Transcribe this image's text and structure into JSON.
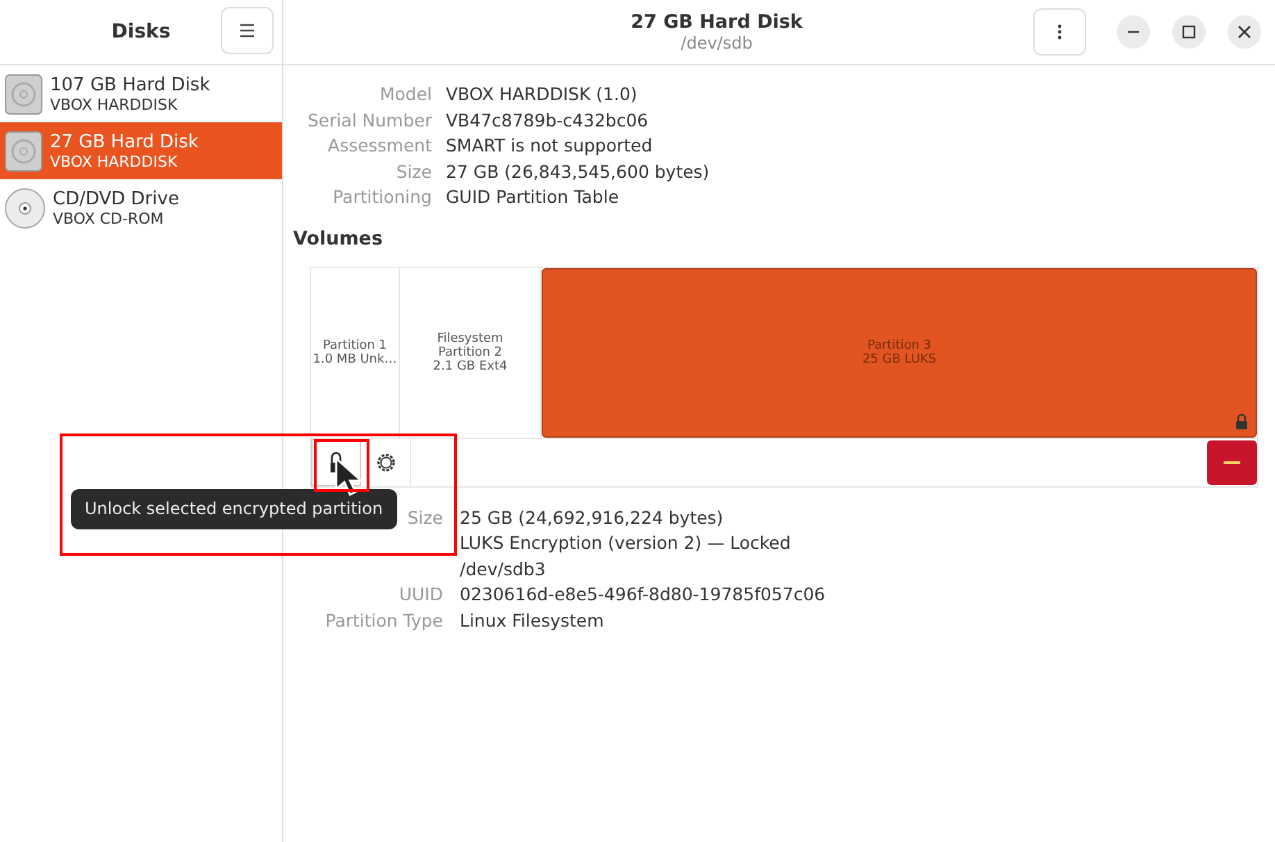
{
  "sidebar": {
    "title": "Disks",
    "items": [
      {
        "kind": "hdd",
        "name": "107 GB Hard Disk",
        "model": "VBOX HARDDISK",
        "selected": false
      },
      {
        "kind": "hdd",
        "name": "27 GB Hard Disk",
        "model": "VBOX HARDDISK",
        "selected": true
      },
      {
        "kind": "optical",
        "name": "CD/DVD Drive",
        "model": "VBOX CD-ROM",
        "selected": false
      }
    ]
  },
  "header": {
    "title": "27 GB Hard Disk",
    "subtitle": "/dev/sdb"
  },
  "disk_info": [
    {
      "label": "Model",
      "value": "VBOX HARDDISK (1.0)"
    },
    {
      "label": "Serial Number",
      "value": "VB47c8789b-c432bc06"
    },
    {
      "label": "Assessment",
      "value": "SMART is not supported"
    },
    {
      "label": "Size",
      "value": "27 GB (26,843,545,600 bytes)"
    },
    {
      "label": "Partitioning",
      "value": "GUID Partition Table"
    }
  ],
  "volumes": {
    "title": "Volumes",
    "partitions": [
      {
        "lines": [
          "Partition 1",
          "1.0 MB Unk…"
        ],
        "selected": false,
        "locked": false
      },
      {
        "lines": [
          "Filesystem",
          "Partition 2",
          "2.1 GB Ext4"
        ],
        "selected": false,
        "locked": false
      },
      {
        "lines": [
          "Partition 3",
          "25 GB LUKS"
        ],
        "selected": true,
        "locked": true
      }
    ],
    "tooltip": "Unlock selected encrypted partition"
  },
  "partition_info": [
    {
      "label": "Size",
      "value": "25 GB (24,692,916,224 bytes)"
    },
    {
      "value": "LUKS Encryption (version 2) — Locked"
    },
    {
      "value": "/dev/sdb3"
    },
    {
      "label": "UUID",
      "value": "0230616d-e8e5-496f-8d80-19785f057c06"
    },
    {
      "label": "Partition Type",
      "value": "Linux Filesystem"
    }
  ]
}
